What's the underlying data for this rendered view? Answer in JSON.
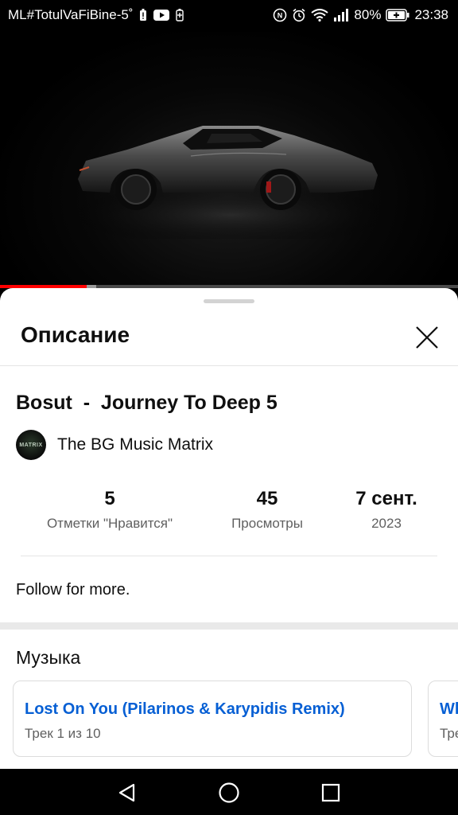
{
  "status_bar": {
    "carrier": "ML#TotulVaFiBine-5˚",
    "battery_percent": "80%",
    "time": "23:38"
  },
  "video": {
    "progress_fraction": 0.19,
    "buffer_fraction": 0.21
  },
  "sheet": {
    "title": "Описание",
    "video_title": "Bosut  -  Journey To Deep 5",
    "channel": {
      "name": "The BG Music Matrix",
      "avatar_text": "MATRIX"
    },
    "stats": [
      {
        "value": "5",
        "label": "Отметки \"Нравится\""
      },
      {
        "value": "45",
        "label": "Просмотры"
      },
      {
        "value": "7 сент.",
        "label": "2023"
      }
    ],
    "description": "Follow for more.",
    "music": {
      "heading": "Музыка",
      "tracks": [
        {
          "title": "Lost On You (Pilarinos & Karypidis Remix)",
          "subtitle": "Трек 1 из 10"
        },
        {
          "title": "Wh",
          "subtitle": "Тре"
        }
      ]
    }
  },
  "colors": {
    "accent_link": "#065fd4",
    "progress": "#ff0000"
  },
  "icons": {
    "close": "close-icon",
    "back": "back-triangle-icon",
    "home": "home-circle-icon",
    "recents": "recents-square-icon"
  }
}
